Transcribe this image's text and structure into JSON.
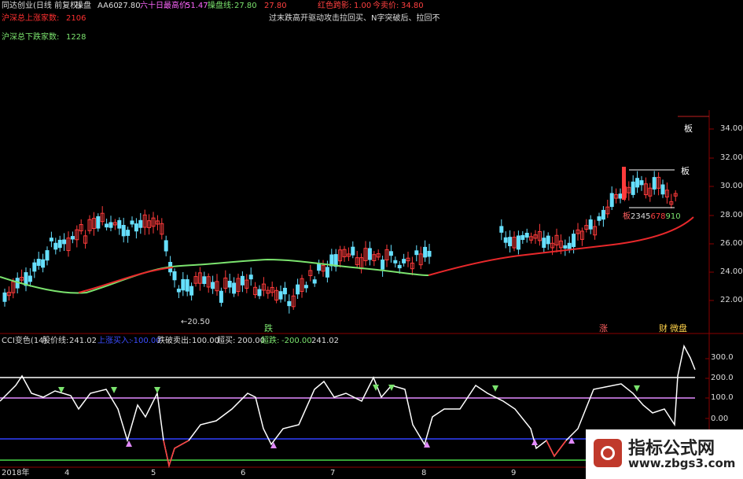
{
  "header": {
    "title": "同达创业(日线 前复权)",
    "mode": "操盘",
    "aa60_label": "AA60:",
    "aa60_value": "27.80",
    "high60_label": "六十日最高价:",
    "high60_value": "51.47",
    "trade_line_label": "操盘线:",
    "trade_line_value": "27.80",
    "trade_line_value2": "27.80",
    "red_flag_label": "红色跨影:",
    "red_flag_value": "1.00",
    "today_price_label": "今卖价:",
    "today_price_value": "34.80",
    "sh_up_label": "沪深总上涨家数:",
    "sh_up_value": "2106",
    "sh_down_label": "沪深总下跌家数:",
    "sh_down_value": "1228",
    "note": "过末跌高开驱动攻击拉回买、N字突破后、拉回不"
  },
  "main_chart": {
    "y_ticks": [
      "34.00",
      "32.00",
      "30.00",
      "28.00",
      "26.00",
      "24.00",
      "22.00"
    ],
    "low_annotation": "←20.50",
    "mark_die": "跌",
    "mark_zhang": "涨",
    "mark_cai": "财",
    "mark_weipan": "微盘",
    "mark_ban1": "板",
    "mark_ban2": "板",
    "count_prefix": "板",
    "count_white": "2345",
    "count_red": "678",
    "count_green": "910"
  },
  "indicator": {
    "name": "CCI变色(14)",
    "price_label": "股价线:",
    "price_value": "241.02",
    "up_buy_label": "上涨买入:",
    "up_buy_value": "-100.00",
    "down_sell_label": "跌破卖出:",
    "down_sell_value": "100.00",
    "overbuy_label": "超买:",
    "overbuy_value": "200.00",
    "oversell_label": "超跌:",
    "oversell_value": "-200.00",
    "last_value": "241.02",
    "y_ticks": [
      "300.0",
      "200.0",
      "100.0",
      "0.00"
    ]
  },
  "x_axis": {
    "labels": [
      "2018年",
      "4",
      "5",
      "6",
      "7",
      "8",
      "9"
    ]
  },
  "watermark": {
    "title": "指标公式网",
    "url": "www.zbgs3.com"
  },
  "colors": {
    "up": "#ff3b3b",
    "down": "#67e0ff",
    "ma_up": "#e8282b",
    "ma_down": "#7be36e",
    "grid": "#8a0000",
    "white_line": "#ffffff",
    "violet_line": "#e28aff",
    "blue_line": "#3040ff",
    "green_line": "#48d848"
  }
}
